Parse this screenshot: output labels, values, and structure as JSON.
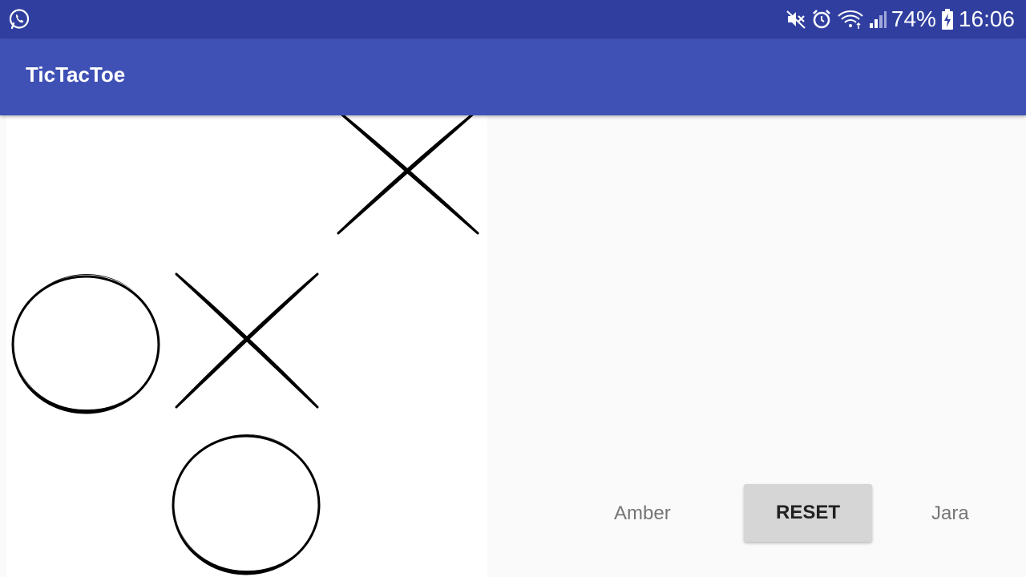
{
  "status_bar": {
    "left_icon": "whatsapp-icon",
    "right_icons": [
      "mute-icon",
      "alarm-icon",
      "wifi-icon",
      "signal-icon"
    ],
    "battery_percent": "74%",
    "battery_icon": "battery-charging-icon",
    "time": "16:06",
    "color": "#303f9f"
  },
  "app_bar": {
    "title": "TicTacToe",
    "color": "#3f51b5"
  },
  "board": {
    "cells": [
      [
        "",
        "",
        "X"
      ],
      [
        "O",
        "X",
        ""
      ],
      [
        "",
        "O",
        ""
      ]
    ]
  },
  "controls": {
    "player_left": "Amber",
    "reset_label": "RESET",
    "player_right": "Jara"
  }
}
